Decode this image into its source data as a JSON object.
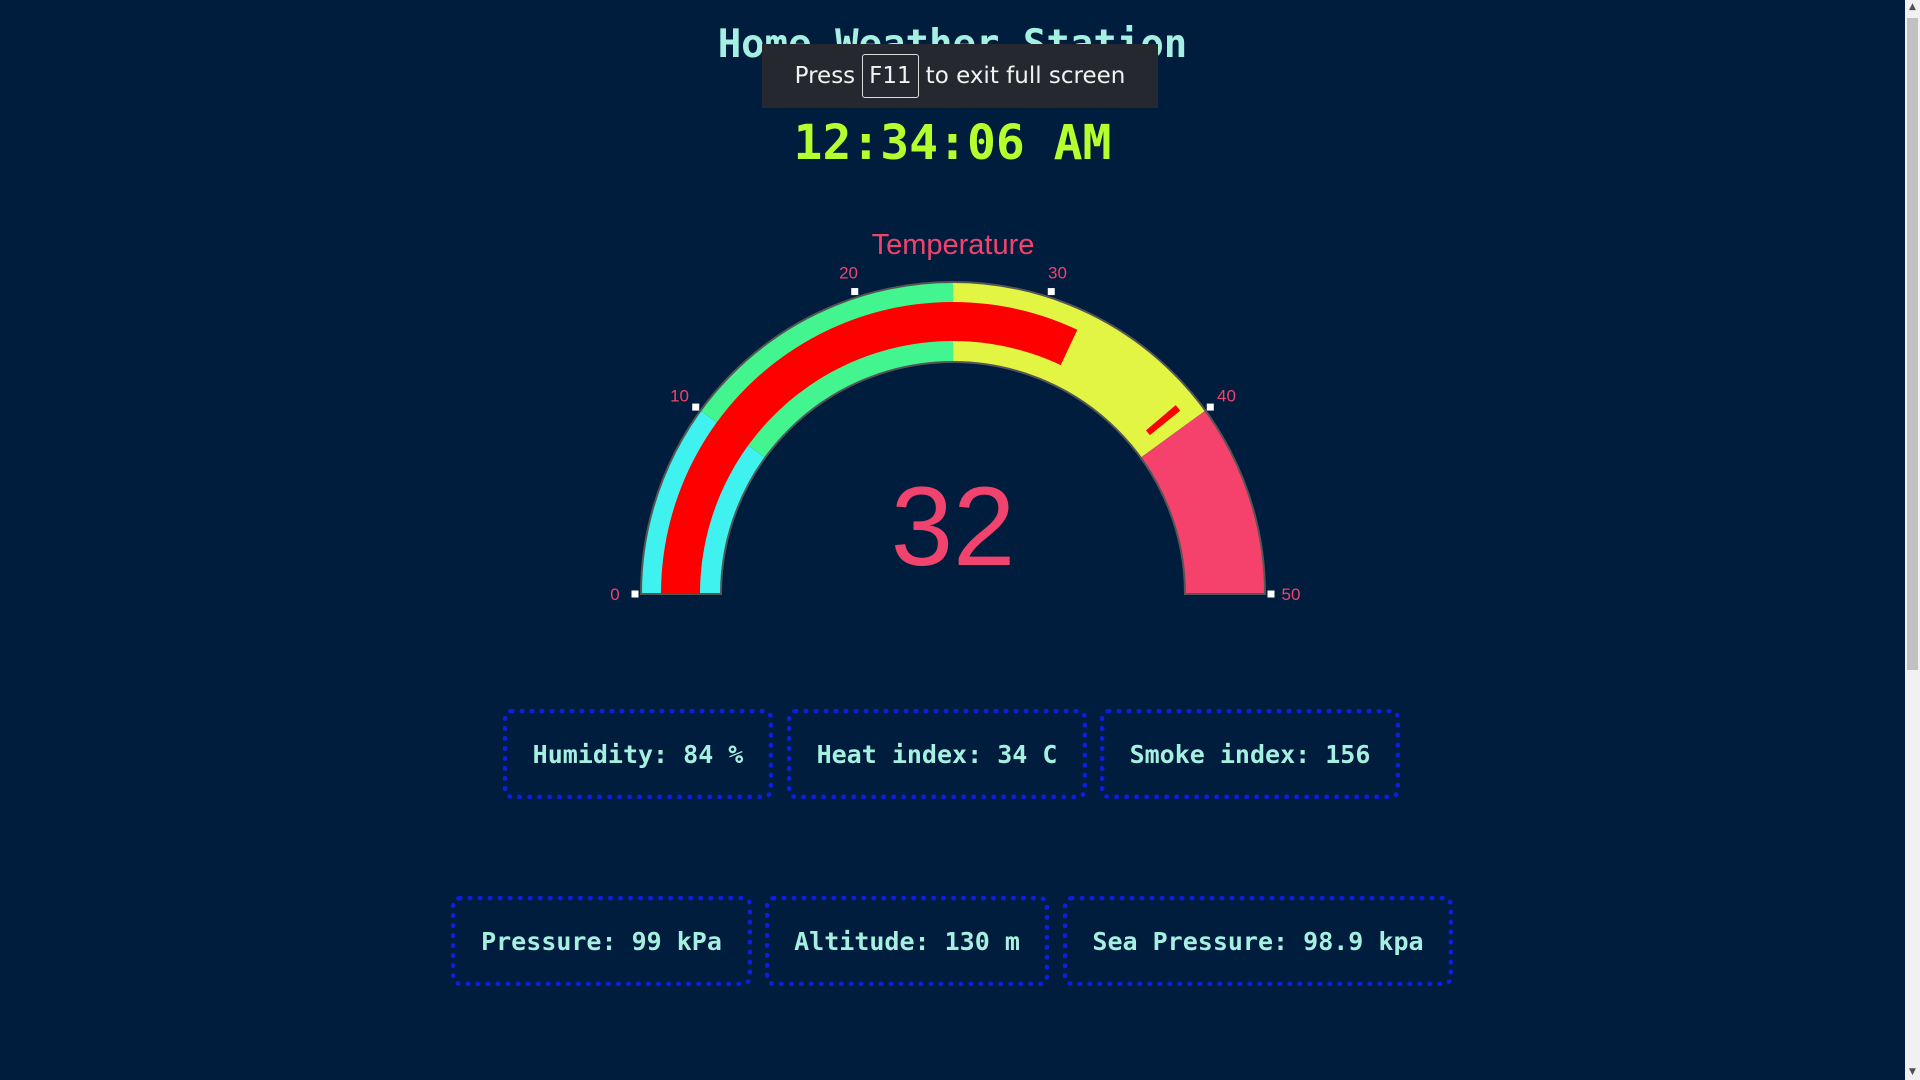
{
  "header": {
    "title": "Home Weather Station",
    "time": "12:34:06 AM"
  },
  "fullscreen_toast": {
    "before": "Press",
    "key": "F11",
    "after": "to exit full screen"
  },
  "gauge": {
    "title": "Temperature",
    "value": 32,
    "value_text": "32",
    "min": 0,
    "max": 50,
    "ticks": [
      "0",
      "10",
      "20",
      "30",
      "40",
      "50"
    ],
    "bands": [
      {
        "from": 0,
        "to": 10,
        "color": "#40f2ef"
      },
      {
        "from": 10,
        "to": 25,
        "color": "#42f58f"
      },
      {
        "from": 25,
        "to": 40,
        "color": "#e1f542"
      },
      {
        "from": 40,
        "to": 50,
        "color": "#f5426c"
      }
    ],
    "value_color": "#ff0000",
    "limit_marker": 39,
    "label_color": "#f0436d"
  },
  "stats": {
    "humidity": "Humidity: 84 %",
    "heat_index": "Heat index: 34 C",
    "smoke_index": "Smoke index: 156",
    "pressure": "Pressure: 99 kPa",
    "altitude": "Altitude: 130 m",
    "sea_pressure": "Sea Pressure: 98.9 kpa"
  },
  "colors": {
    "background": "#001d3d",
    "title": "#a6f0e2",
    "clock": "#b6ff2e",
    "box_border": "#0d1ee0"
  }
}
